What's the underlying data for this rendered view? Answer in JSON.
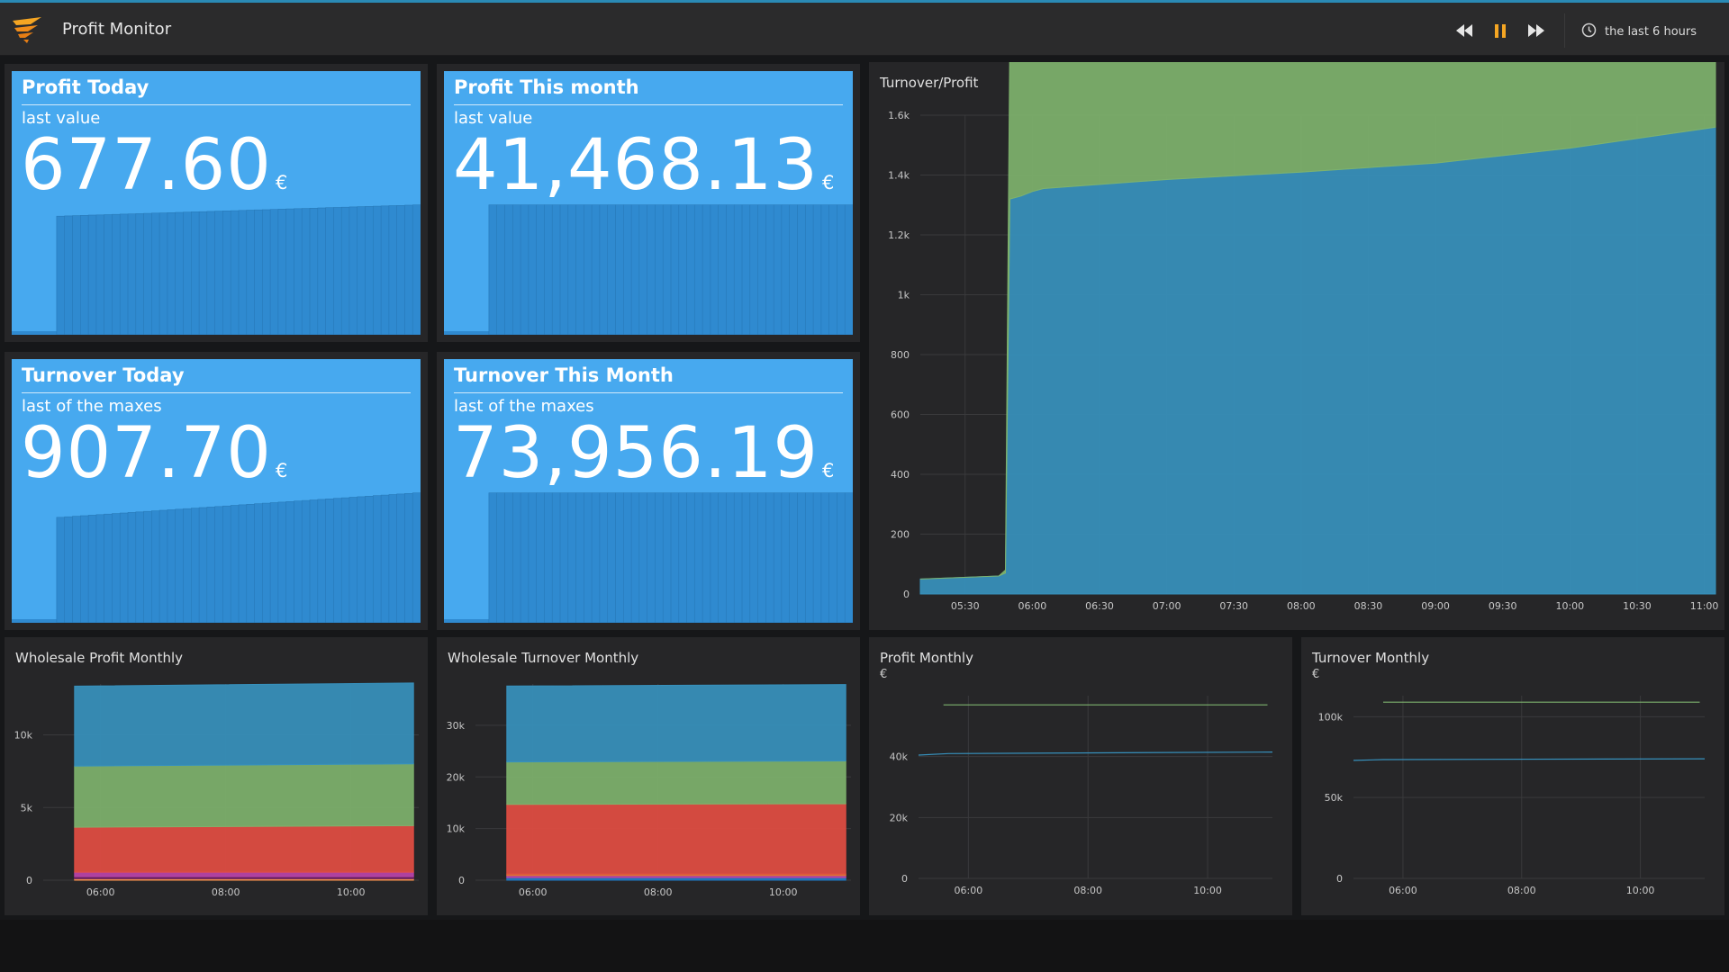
{
  "app": {
    "title": "Profit Monitor",
    "time_range": "the last 6 hours",
    "icons": {
      "logo": "orange-wing-logo",
      "rewind": "rewind-icon",
      "pause": "pause-icon",
      "forward": "fast-forward-icon",
      "clock": "clock-icon"
    },
    "colors": {
      "accent": "#2a8ab5",
      "stat_bg": "#47a9ef",
      "pause": "#f5a623",
      "series_blue": "#3791bd",
      "series_green": "#7eb26d",
      "series_red": "#e24d42"
    }
  },
  "stats": [
    {
      "title": "Profit Today",
      "subtitle": "last value",
      "value": "677.60",
      "unit": "€"
    },
    {
      "title": "Profit This month",
      "subtitle": "last value",
      "value": "41,468.13",
      "unit": "€"
    },
    {
      "title": "Turnover Today",
      "subtitle": "last of the maxes",
      "value": "907.70",
      "unit": "€"
    },
    {
      "title": "Turnover This Month",
      "subtitle": "last of the maxes",
      "value": "73,956.19",
      "unit": "€"
    }
  ],
  "panels": {
    "turnover_profit": {
      "title": "Turnover/Profit"
    },
    "wholesale_profit": {
      "title": "Wholesale Profit Monthly"
    },
    "wholesale_turnover": {
      "title": "Wholesale Turnover Monthly"
    },
    "profit_monthly": {
      "title": "Profit Monthly",
      "unit": "€"
    },
    "turnover_monthly": {
      "title": "Turnover Monthly",
      "unit": "€"
    }
  },
  "chart_data": [
    {
      "id": "turnover_profit",
      "type": "area",
      "title": "Turnover/Profit",
      "ylim": [
        0,
        1600
      ],
      "yticks": [
        0,
        200,
        400,
        600,
        800,
        1000,
        1200,
        1400,
        1600
      ],
      "ytick_labels": [
        "0",
        "200",
        "400",
        "600",
        "800",
        "1k",
        "1.2k",
        "1.4k",
        "1.6k"
      ],
      "xlim": [
        "05:10",
        "11:05"
      ],
      "xticks": [
        "05:30",
        "06:00",
        "06:30",
        "07:00",
        "07:30",
        "08:00",
        "08:30",
        "09:00",
        "09:30",
        "10:00",
        "10:30",
        "11:00"
      ],
      "x": [
        "05:10",
        "05:45",
        "05:48",
        "05:50",
        "05:55",
        "06:00",
        "06:05",
        "07:00",
        "08:00",
        "09:00",
        "10:00",
        "11:05"
      ],
      "series": [
        {
          "color": "#3791bd",
          "values": [
            50,
            60,
            70,
            1320,
            1330,
            1345,
            1355,
            1385,
            1410,
            1440,
            1490,
            1560
          ]
        },
        {
          "color": "#7eb26d",
          "values": [
            0,
            0,
            10,
            580,
            585,
            590,
            605,
            610,
            612,
            618,
            630,
            660
          ]
        }
      ],
      "grid": true
    },
    {
      "id": "wholesale_profit",
      "type": "area",
      "title": "Wholesale Profit Monthly",
      "ylim": [
        0,
        13500
      ],
      "yticks": [
        0,
        5000,
        10000
      ],
      "ytick_labels": [
        "0",
        "5k",
        "10k"
      ],
      "xlim": [
        "05:05",
        "11:05"
      ],
      "xticks": [
        "06:00",
        "08:00",
        "10:00"
      ],
      "x": [
        "05:35",
        "11:00"
      ],
      "series": [
        {
          "color": "#f9934e",
          "values": [
            100,
            100
          ]
        },
        {
          "color": "#6d1f62",
          "values": [
            150,
            150
          ]
        },
        {
          "color": "#ba43a9",
          "values": [
            300,
            300
          ]
        },
        {
          "color": "#e24d42",
          "values": [
            3100,
            3200
          ]
        },
        {
          "color": "#7eb26d",
          "values": [
            4200,
            4250
          ]
        },
        {
          "color": "#3791bd",
          "values": [
            5500,
            5570
          ]
        }
      ],
      "grid": true
    },
    {
      "id": "wholesale_turnover",
      "type": "area",
      "title": "Wholesale Turnover Monthly",
      "ylim": [
        0,
        38000
      ],
      "yticks": [
        0,
        10000,
        20000,
        30000
      ],
      "ytick_labels": [
        "0",
        "10k",
        "20k",
        "30k"
      ],
      "xlim": [
        "05:05",
        "11:05"
      ],
      "xticks": [
        "06:00",
        "08:00",
        "10:00"
      ],
      "x": [
        "05:35",
        "11:00"
      ],
      "series": [
        {
          "color": "#1f78c1",
          "values": [
            500,
            500
          ]
        },
        {
          "color": "#ba43a9",
          "values": [
            400,
            400
          ]
        },
        {
          "color": "#e0752d",
          "values": [
            300,
            300
          ]
        },
        {
          "color": "#e24d42",
          "values": [
            13500,
            13600
          ]
        },
        {
          "color": "#7eb26d",
          "values": [
            8200,
            8300
          ]
        },
        {
          "color": "#3791bd",
          "values": [
            14700,
            14800
          ]
        }
      ],
      "grid": true
    },
    {
      "id": "profit_monthly",
      "type": "line",
      "title": "Profit Monthly",
      "ylim": [
        0,
        60000
      ],
      "yticks": [
        0,
        20000,
        40000
      ],
      "ytick_labels": [
        "0",
        "20k",
        "40k"
      ],
      "xlim": [
        "05:10",
        "11:05"
      ],
      "xticks": [
        "06:00",
        "08:00",
        "10:00"
      ],
      "series": [
        {
          "color": "#7eb26d",
          "x": [
            "05:35",
            "11:00"
          ],
          "values": [
            57000,
            57000
          ]
        },
        {
          "color": "#3791bd",
          "x": [
            "05:10",
            "05:40",
            "11:05"
          ],
          "values": [
            40500,
            41000,
            41500
          ]
        }
      ],
      "grid": true
    },
    {
      "id": "turnover_monthly",
      "type": "line",
      "title": "Turnover Monthly",
      "ylim": [
        0,
        113000
      ],
      "yticks": [
        0,
        50000,
        100000
      ],
      "ytick_labels": [
        "0",
        "50k",
        "100k"
      ],
      "xlim": [
        "05:10",
        "11:05"
      ],
      "xticks": [
        "06:00",
        "08:00",
        "10:00"
      ],
      "series": [
        {
          "color": "#7eb26d",
          "x": [
            "05:40",
            "11:00"
          ],
          "values": [
            109000,
            109000
          ]
        },
        {
          "color": "#3791bd",
          "x": [
            "05:10",
            "05:40",
            "11:05"
          ],
          "values": [
            73000,
            73500,
            74000
          ]
        }
      ],
      "grid": true
    }
  ]
}
